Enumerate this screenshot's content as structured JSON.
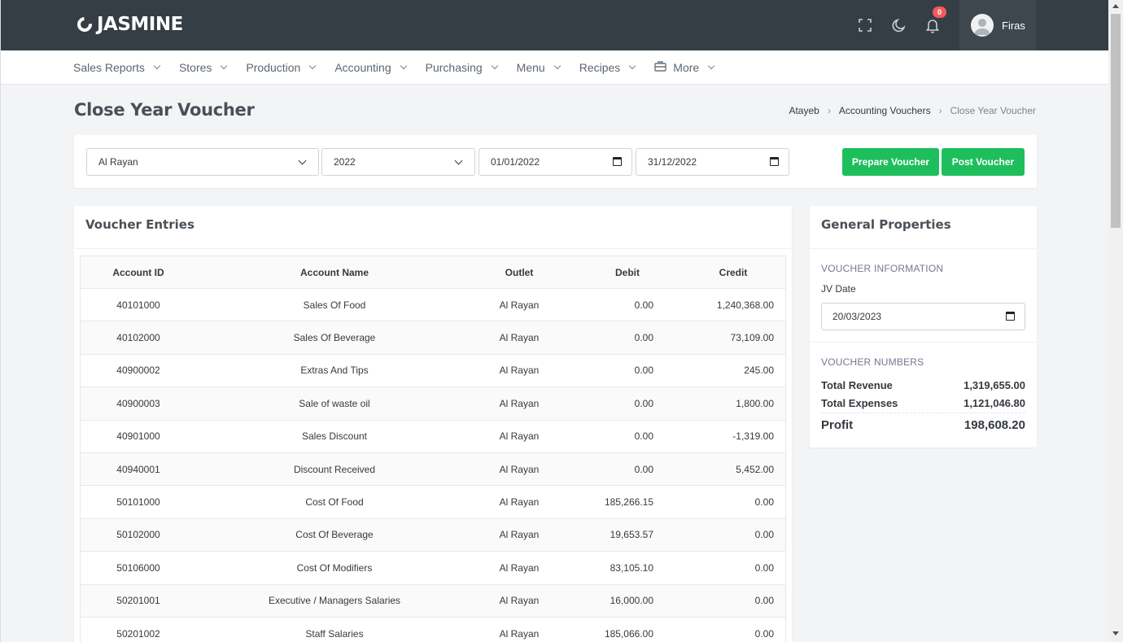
{
  "app": {
    "name": "JASMINE",
    "username": "Firas",
    "notification_count": "0"
  },
  "menu": [
    {
      "label": "Sales Reports"
    },
    {
      "label": "Stores"
    },
    {
      "label": "Production"
    },
    {
      "label": "Accounting"
    },
    {
      "label": "Purchasing"
    },
    {
      "label": "Menu"
    },
    {
      "label": "Recipes"
    },
    {
      "label": "More"
    }
  ],
  "page": {
    "title": "Close Year Voucher",
    "breadcrumb": [
      "Atayeb",
      "Accounting Vouchers",
      "Close Year Voucher"
    ]
  },
  "filters": {
    "outlet": "Al Rayan",
    "year": "2022",
    "date_from": "01/01/2022",
    "date_to": "31/12/2022",
    "prepare_label": "Prepare Voucher",
    "post_label": "Post Voucher"
  },
  "entries": {
    "title": "Voucher Entries",
    "columns": [
      "Account ID",
      "Account Name",
      "Outlet",
      "Debit",
      "Credit"
    ],
    "rows": [
      [
        "40101000",
        "Sales Of Food",
        "Al Rayan",
        "0.00",
        "1,240,368.00"
      ],
      [
        "40102000",
        "Sales Of Beverage",
        "Al Rayan",
        "0.00",
        "73,109.00"
      ],
      [
        "40900002",
        "Extras And Tips",
        "Al Rayan",
        "0.00",
        "245.00"
      ],
      [
        "40900003",
        "Sale of waste oil",
        "Al Rayan",
        "0.00",
        "1,800.00"
      ],
      [
        "40901000",
        "Sales Discount",
        "Al Rayan",
        "0.00",
        "-1,319.00"
      ],
      [
        "40940001",
        "Discount Received",
        "Al Rayan",
        "0.00",
        "5,452.00"
      ],
      [
        "50101000",
        "Cost Of Food",
        "Al Rayan",
        "185,266.15",
        "0.00"
      ],
      [
        "50102000",
        "Cost Of Beverage",
        "Al Rayan",
        "19,653.57",
        "0.00"
      ],
      [
        "50106000",
        "Cost Of Modifiers",
        "Al Rayan",
        "83,105.10",
        "0.00"
      ],
      [
        "50201001",
        "Executive / Managers Salaries",
        "Al Rayan",
        "16,000.00",
        "0.00"
      ],
      [
        "50201002",
        "Staff Salaries",
        "Al Rayan",
        "185,066.00",
        "0.00"
      ]
    ]
  },
  "properties": {
    "title": "General Properties",
    "info_heading": "VOUCHER INFORMATION",
    "jv_date_label": "JV Date",
    "jv_date": "20/03/2023",
    "numbers_heading": "VOUCHER NUMBERS",
    "total_revenue_label": "Total Revenue",
    "total_revenue": "1,319,655.00",
    "total_expenses_label": "Total Expenses",
    "total_expenses": "1,121,046.80",
    "profit_label": "Profit",
    "profit": "198,608.20"
  },
  "colors": {
    "topbar": "#343e44",
    "accent_green": "#1ebe5c",
    "badge": "#f05b5b"
  },
  "icons": [
    "fullscreen-icon",
    "moon-icon",
    "bell-icon",
    "user-avatar-icon",
    "briefcase-icon",
    "calendar-icon",
    "chevron-down-icon"
  ]
}
